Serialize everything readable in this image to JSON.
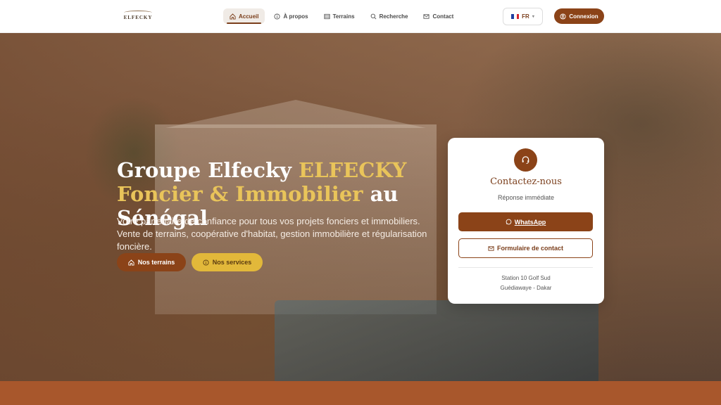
{
  "nav": {
    "logo_text": "ELFECKY",
    "items": [
      {
        "label": "Accueil",
        "icon": "home-icon",
        "active": true
      },
      {
        "label": "À propos",
        "icon": "info-icon"
      },
      {
        "label": "Terrains",
        "icon": "grid-icon"
      },
      {
        "label": "Recherche",
        "icon": "search-icon"
      },
      {
        "label": "Contact",
        "icon": "mail-icon"
      }
    ],
    "language": "FR",
    "login_label": "Connexion"
  },
  "hero": {
    "title_part1": "Groupe Elfecky ",
    "title_gold1": "ELFECKY",
    "title_gold2": "Foncier & Immobilier",
    "title_part2": " au Sénégal",
    "subtitle": "Votre partenaire de confiance pour tous vos projets fonciers et immobiliers. Vente de terrains, coopérative d'habitat, gestion immobilière et régularisation foncière.",
    "btn_terrains": "Nos terrains",
    "btn_services": "Nos services"
  },
  "contact_card": {
    "title": "Contactez-nous",
    "subtitle": "Réponse immédiate",
    "whatsapp_label": "WhatsApp",
    "form_label": "Formulaire de contact",
    "address_line1": "Station 10 Golf Sud",
    "address_line2": "Guédiawaye - Dakar"
  },
  "colors": {
    "brand_brown": "#8b4318",
    "gold": "#e9c45a",
    "button_gold": "#e2b83a"
  }
}
